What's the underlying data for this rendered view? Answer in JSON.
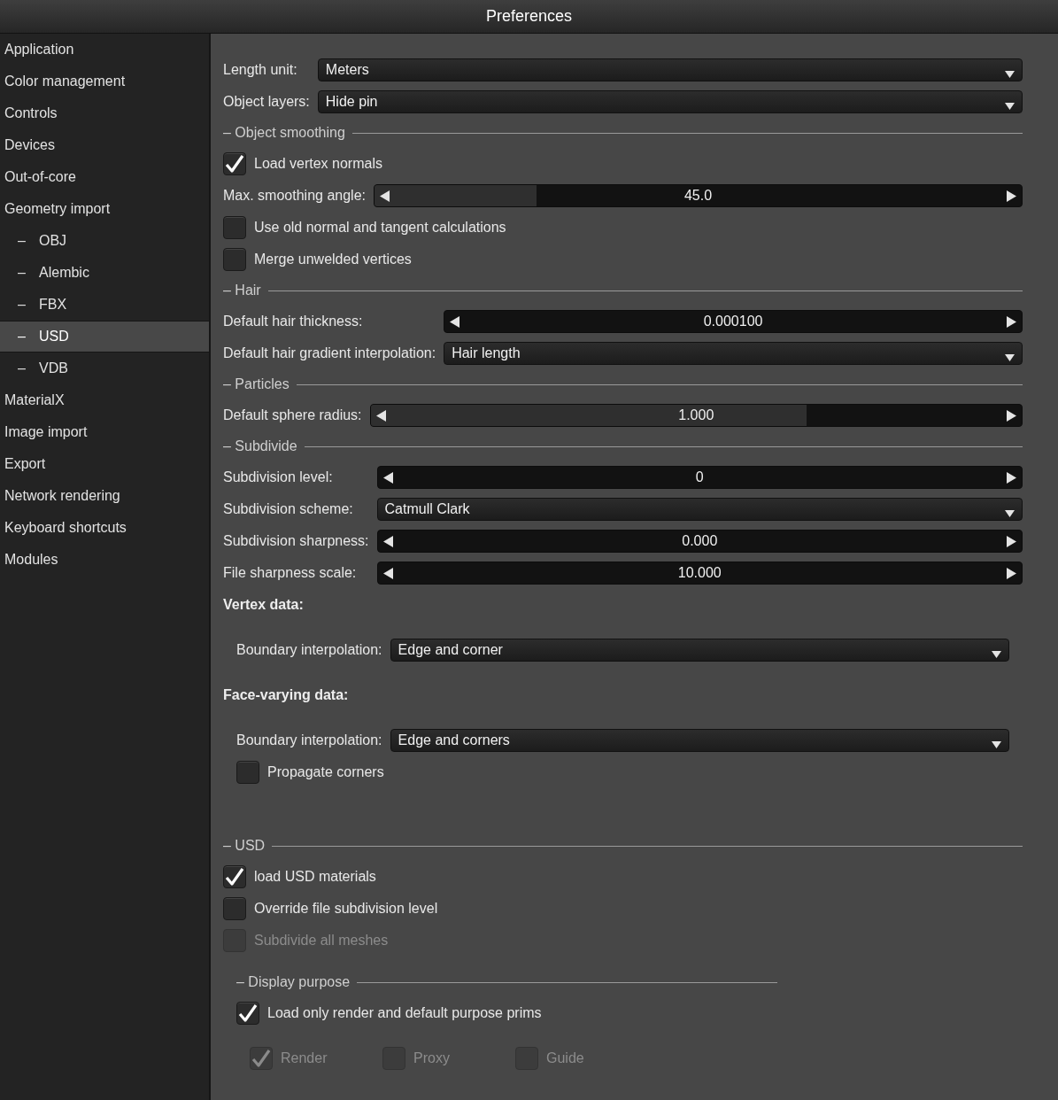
{
  "window": {
    "title": "Preferences"
  },
  "sidebar": {
    "items": [
      {
        "label": "Application",
        "selected": false
      },
      {
        "label": "Color management",
        "selected": false
      },
      {
        "label": "Controls",
        "selected": false
      },
      {
        "label": "Devices",
        "selected": false
      },
      {
        "label": "Out-of-core",
        "selected": false
      },
      {
        "label": "Geometry import",
        "selected": false,
        "children": [
          {
            "bullet": "–",
            "label": "OBJ",
            "selected": false
          },
          {
            "bullet": "–",
            "label": "Alembic",
            "selected": false
          },
          {
            "bullet": "–",
            "label": "FBX",
            "selected": false
          },
          {
            "bullet": "–",
            "label": "USD",
            "selected": true
          },
          {
            "bullet": "–",
            "label": "VDB",
            "selected": false
          }
        ]
      },
      {
        "label": "MaterialX",
        "selected": false
      },
      {
        "label": "Image import",
        "selected": false
      },
      {
        "label": "Export",
        "selected": false
      },
      {
        "label": "Network rendering",
        "selected": false
      },
      {
        "label": "Keyboard shortcuts",
        "selected": false
      },
      {
        "label": "Modules",
        "selected": false
      }
    ]
  },
  "sections": [
    {
      "rows": [
        {
          "kind": "dropdown",
          "label": "Length unit:",
          "value": "Meters"
        },
        {
          "kind": "dropdown",
          "label": "Object layers:",
          "value": "Hide pin"
        }
      ]
    },
    {
      "title": "– Object smoothing",
      "rows": [
        {
          "kind": "checkbox",
          "label": "Load vertex normals",
          "checked": true,
          "disabled": false
        },
        {
          "kind": "slider",
          "label": "Max. smoothing angle:",
          "value": "45.0",
          "level": 0.25
        },
        {
          "kind": "checkbox",
          "label": "Use old normal and tangent calculations",
          "checked": false,
          "disabled": false
        },
        {
          "kind": "checkbox",
          "label": "Merge unwelded vertices",
          "checked": false,
          "disabled": false
        }
      ]
    },
    {
      "title": "– Hair",
      "rows": [
        {
          "kind": "slider",
          "label": "Default hair thickness:",
          "value": "0.000100",
          "level": 0
        },
        {
          "kind": "dropdown",
          "label": "Default hair gradient interpolation:",
          "value": "Hair length"
        }
      ]
    },
    {
      "title": "– Particles",
      "rows": [
        {
          "kind": "slider",
          "label": "Default sphere radius:",
          "value": "1.000",
          "level": 0.67
        }
      ]
    },
    {
      "title": "– Subdivide",
      "rows": [
        {
          "kind": "slider",
          "label": "Subdivision level:",
          "value": "0",
          "level": 0
        },
        {
          "kind": "dropdown",
          "label": "Subdivision scheme:",
          "value": "Catmull Clark"
        },
        {
          "kind": "slider",
          "label": "Subdivision sharpness:",
          "value": "0.000",
          "level": 0
        },
        {
          "kind": "slider",
          "label": "File sharpness scale:",
          "value": "10.000",
          "level": 0
        },
        {
          "kind": "group",
          "title": "Vertex data:",
          "rows": [
            {
              "kind": "dropdown",
              "label": "Boundary interpolation:",
              "value": "Edge and corner"
            }
          ]
        },
        {
          "kind": "group",
          "title": "Face-varying data:",
          "rows": [
            {
              "kind": "dropdown",
              "label": "Boundary interpolation:",
              "value": "Edge and corners"
            },
            {
              "kind": "checkbox",
              "label": "Propagate corners",
              "checked": false,
              "disabled": false
            }
          ]
        }
      ]
    },
    {
      "title": "– USD",
      "rows": [
        {
          "kind": "checkbox",
          "label": "load USD materials",
          "checked": true,
          "disabled": false
        },
        {
          "kind": "checkbox",
          "label": "Override file subdivision level",
          "checked": false,
          "disabled": false
        },
        {
          "kind": "checkbox",
          "label": "Subdivide all meshes",
          "checked": false,
          "disabled": true
        },
        {
          "kind": "subsection",
          "title": "– Display purpose",
          "rows": [
            {
              "kind": "checkbox",
              "label": "Load only render and default purpose prims",
              "checked": true,
              "disabled": false
            },
            {
              "kind": "checkbox_row",
              "items": [
                {
                  "label": "Render",
                  "checked": true,
                  "disabled": true
                },
                {
                  "label": "Proxy",
                  "checked": false,
                  "disabled": true
                },
                {
                  "label": "Guide",
                  "checked": false,
                  "disabled": true
                }
              ]
            }
          ]
        }
      ]
    }
  ]
}
